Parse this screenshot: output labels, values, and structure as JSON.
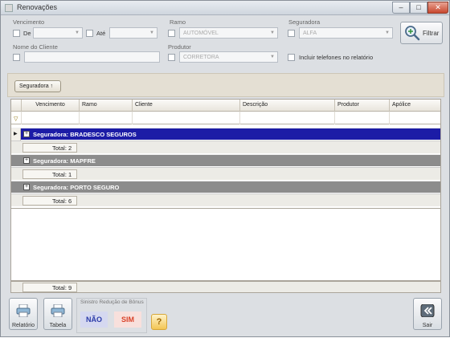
{
  "window": {
    "title": "Renovações"
  },
  "filters": {
    "vencimento_label": "Vencimento",
    "de_label": "De",
    "ate_label": "Até",
    "ate_value": "",
    "ramo_label": "Ramo",
    "ramo_value": "AUTOMÓVEL",
    "seguradora_label": "Seguradora",
    "seguradora_value": "ALFA",
    "nome_cliente_label": "Nome do Cliente",
    "produtor_label": "Produtor",
    "produtor_value": "CORRETORA",
    "incluir_telefones_label": "Incluir telefones no relatório",
    "filtrar_label": "Filtrar"
  },
  "grouping": {
    "chip_label": "Seguradora"
  },
  "grid": {
    "columns": [
      "Vencimento",
      "Ramo",
      "Cliente",
      "Descrição",
      "Produtor",
      "Apólice"
    ],
    "groups": [
      {
        "label": "Seguradora: BRADESCO SEGUROS",
        "total": "Total: 2"
      },
      {
        "label": "Seguradora: MAPFRE",
        "total": "Total: 1"
      },
      {
        "label": "Seguradora: PORTO SEGURO",
        "total": "Total: 6"
      }
    ],
    "grand_total": "Total: 9"
  },
  "bottom": {
    "relatorio_label": "Relatório",
    "tabela_label": "Tabela",
    "sinistro_label": "Sinistro Redução de Bônus",
    "nao_label": "NÃO",
    "sim_label": "SIM",
    "help_label": "?",
    "sair_label": "Sair"
  },
  "colors": {
    "selected_group": "#1c1ca6",
    "group": "#8c8c8c",
    "nao": "#2a3aa8",
    "sim": "#d9432a"
  }
}
